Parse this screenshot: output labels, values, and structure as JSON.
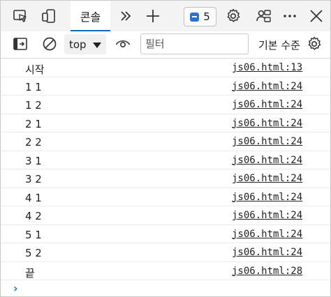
{
  "tabs": {
    "console_label": "콘솔",
    "icons": [
      "inspect-element-icon",
      "device-emulation-icon",
      "more-tabs-icon",
      "add-tab-icon",
      "settings-icon",
      "feedback-icon",
      "more-options-icon",
      "close-icon"
    ],
    "issues_count": "5"
  },
  "toolbar": {
    "context_value": "top",
    "filter_placeholder": "필터",
    "levels_label": "기본 수준"
  },
  "log": [
    {
      "message": "시작",
      "source": "js06.html:13"
    },
    {
      "message": "1 1",
      "source": "js06.html:24"
    },
    {
      "message": "1 2",
      "source": "js06.html:24"
    },
    {
      "message": "2 1",
      "source": "js06.html:24"
    },
    {
      "message": "2 2",
      "source": "js06.html:24"
    },
    {
      "message": "3 1",
      "source": "js06.html:24"
    },
    {
      "message": "3 2",
      "source": "js06.html:24"
    },
    {
      "message": "4 1",
      "source": "js06.html:24"
    },
    {
      "message": "4 2",
      "source": "js06.html:24"
    },
    {
      "message": "5 1",
      "source": "js06.html:24"
    },
    {
      "message": "5 2",
      "source": "js06.html:24"
    },
    {
      "message": "끝",
      "source": "js06.html:28"
    }
  ],
  "colors": {
    "accent": "#0f6cbd",
    "prompt": "#1a73e8",
    "badge": "#2f6fd6"
  }
}
